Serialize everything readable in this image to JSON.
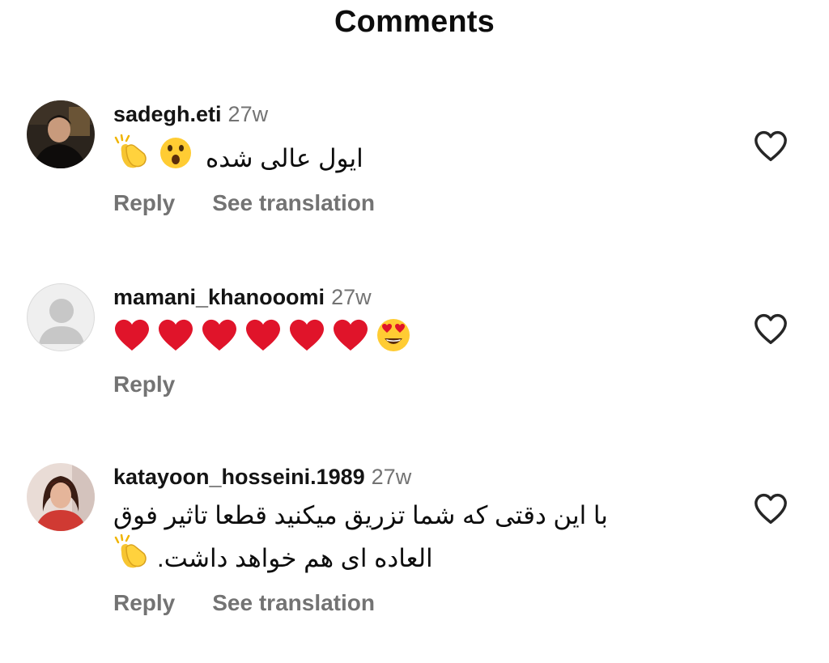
{
  "header": {
    "title": "Comments"
  },
  "comments": [
    {
      "username": "sadegh.eti",
      "time": "27w",
      "text": "ایول  عالی شده",
      "actions": {
        "reply": "Reply",
        "translate": "See translation"
      }
    },
    {
      "username": "mamani_khanooomi",
      "time": "27w",
      "actions": {
        "reply": "Reply"
      }
    },
    {
      "username": "katayoon_hosseini.1989",
      "time": "27w",
      "text_line1": "با این دقتی که شما تزریق میکنید قطعا تاثیر فوق",
      "text_line2": "العاده ای هم خواهد داشت.",
      "actions": {
        "reply": "Reply",
        "translate": "See translation"
      }
    }
  ],
  "icons": {
    "like": "heart-outline-icon",
    "clap": "clapping-hands-emoji",
    "surprised": "surprised-face-emoji",
    "red_heart": "red-heart-emoji",
    "heart_eyes": "heart-eyes-emoji"
  }
}
